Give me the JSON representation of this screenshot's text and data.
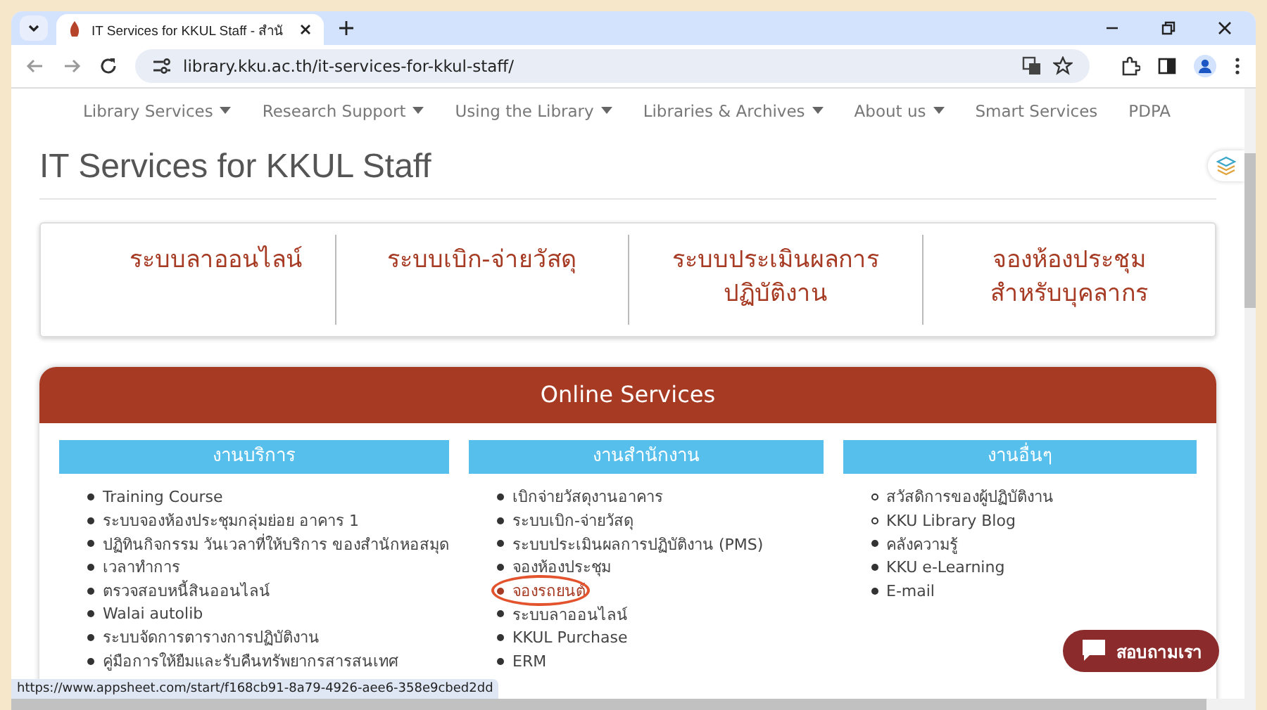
{
  "browser": {
    "tab_title": "IT Services for KKUL Staff - สำนั",
    "url": "library.kku.ac.th/it-services-for-kkul-staff/",
    "status_url": "https://www.appsheet.com/start/f168cb91-8a79-4926-aee6-358e9cbed2dd"
  },
  "nav": [
    {
      "label": "Library Services",
      "dropdown": true
    },
    {
      "label": "Research Support",
      "dropdown": true
    },
    {
      "label": "Using the Library",
      "dropdown": true
    },
    {
      "label": "Libraries & Archives",
      "dropdown": true
    },
    {
      "label": "About us",
      "dropdown": true
    },
    {
      "label": "Smart Services",
      "dropdown": false
    },
    {
      "label": "PDPA",
      "dropdown": false
    }
  ],
  "page_title": "IT Services for KKUL Staff",
  "quick_links": [
    {
      "lines": [
        "ระบบลาออนไลน์"
      ]
    },
    {
      "lines": [
        "ระบบเบิก-จ่ายวัสดุ"
      ]
    },
    {
      "lines": [
        "ระบบประเมินผลการ",
        "ปฏิบัติงาน"
      ]
    },
    {
      "lines": [
        "จองห้องประชุม",
        "สำหรับบุคลากร"
      ]
    }
  ],
  "online_services": {
    "title": "Online Services",
    "columns": [
      {
        "heading": "งานบริการ",
        "items": [
          {
            "label": "Training Course",
            "kind": "dot",
            "highlighted": false
          },
          {
            "label": "ระบบจองห้องประชุมกลุ่มย่อย อาคาร 1",
            "kind": "dot",
            "highlighted": false
          },
          {
            "label": "ปฏิทินกิจกรรม วันเวลาที่ให้บริการ ของสำนักหอสมุด",
            "kind": "dot",
            "highlighted": false
          },
          {
            "label": "เวลาทำการ",
            "kind": "dot",
            "highlighted": false
          },
          {
            "label": "ตรวจสอบหนี้สินออนไลน์",
            "kind": "dot",
            "highlighted": false
          },
          {
            "label": "Walai autolib",
            "kind": "dot",
            "highlighted": false
          },
          {
            "label": "ระบบจัดการตารางการปฏิบัติงาน",
            "kind": "dot",
            "highlighted": false
          },
          {
            "label": "คู่มือการให้ยืมและรับคืนทรัพยากรสารสนเทศ",
            "kind": "dot",
            "highlighted": false
          }
        ]
      },
      {
        "heading": "งานสำนักงาน",
        "items": [
          {
            "label": "เบิกจ่ายวัสดุงานอาคาร",
            "kind": "dot",
            "highlighted": false
          },
          {
            "label": "ระบบเบิก-จ่ายวัสดุ",
            "kind": "dot",
            "highlighted": false
          },
          {
            "label": "ระบบประเมินผลการปฏิบัติงาน (PMS)",
            "kind": "dot",
            "highlighted": false
          },
          {
            "label": "จองห้องประชุม",
            "kind": "dot",
            "highlighted": false
          },
          {
            "label": "จองรถยนต์",
            "kind": "dot",
            "highlighted": true
          },
          {
            "label": "ระบบลาออนไลน์",
            "kind": "dot",
            "highlighted": false
          },
          {
            "label": "KKUL Purchase",
            "kind": "dot",
            "highlighted": false
          },
          {
            "label": "ERM",
            "kind": "dot",
            "highlighted": false
          }
        ]
      },
      {
        "heading": "งานอื่นๆ",
        "items": [
          {
            "label": "สวัสดิการของผู้ปฏิบัติงาน",
            "kind": "ring",
            "highlighted": false
          },
          {
            "label": "KKU Library Blog",
            "kind": "ring",
            "highlighted": false
          },
          {
            "label": "คลังความรู้",
            "kind": "dot",
            "highlighted": false
          },
          {
            "label": "KKU e-Learning",
            "kind": "dot",
            "highlighted": false
          },
          {
            "label": "E-mail",
            "kind": "dot",
            "highlighted": false
          }
        ]
      }
    ]
  },
  "chat_button": "สอบถามเรา"
}
